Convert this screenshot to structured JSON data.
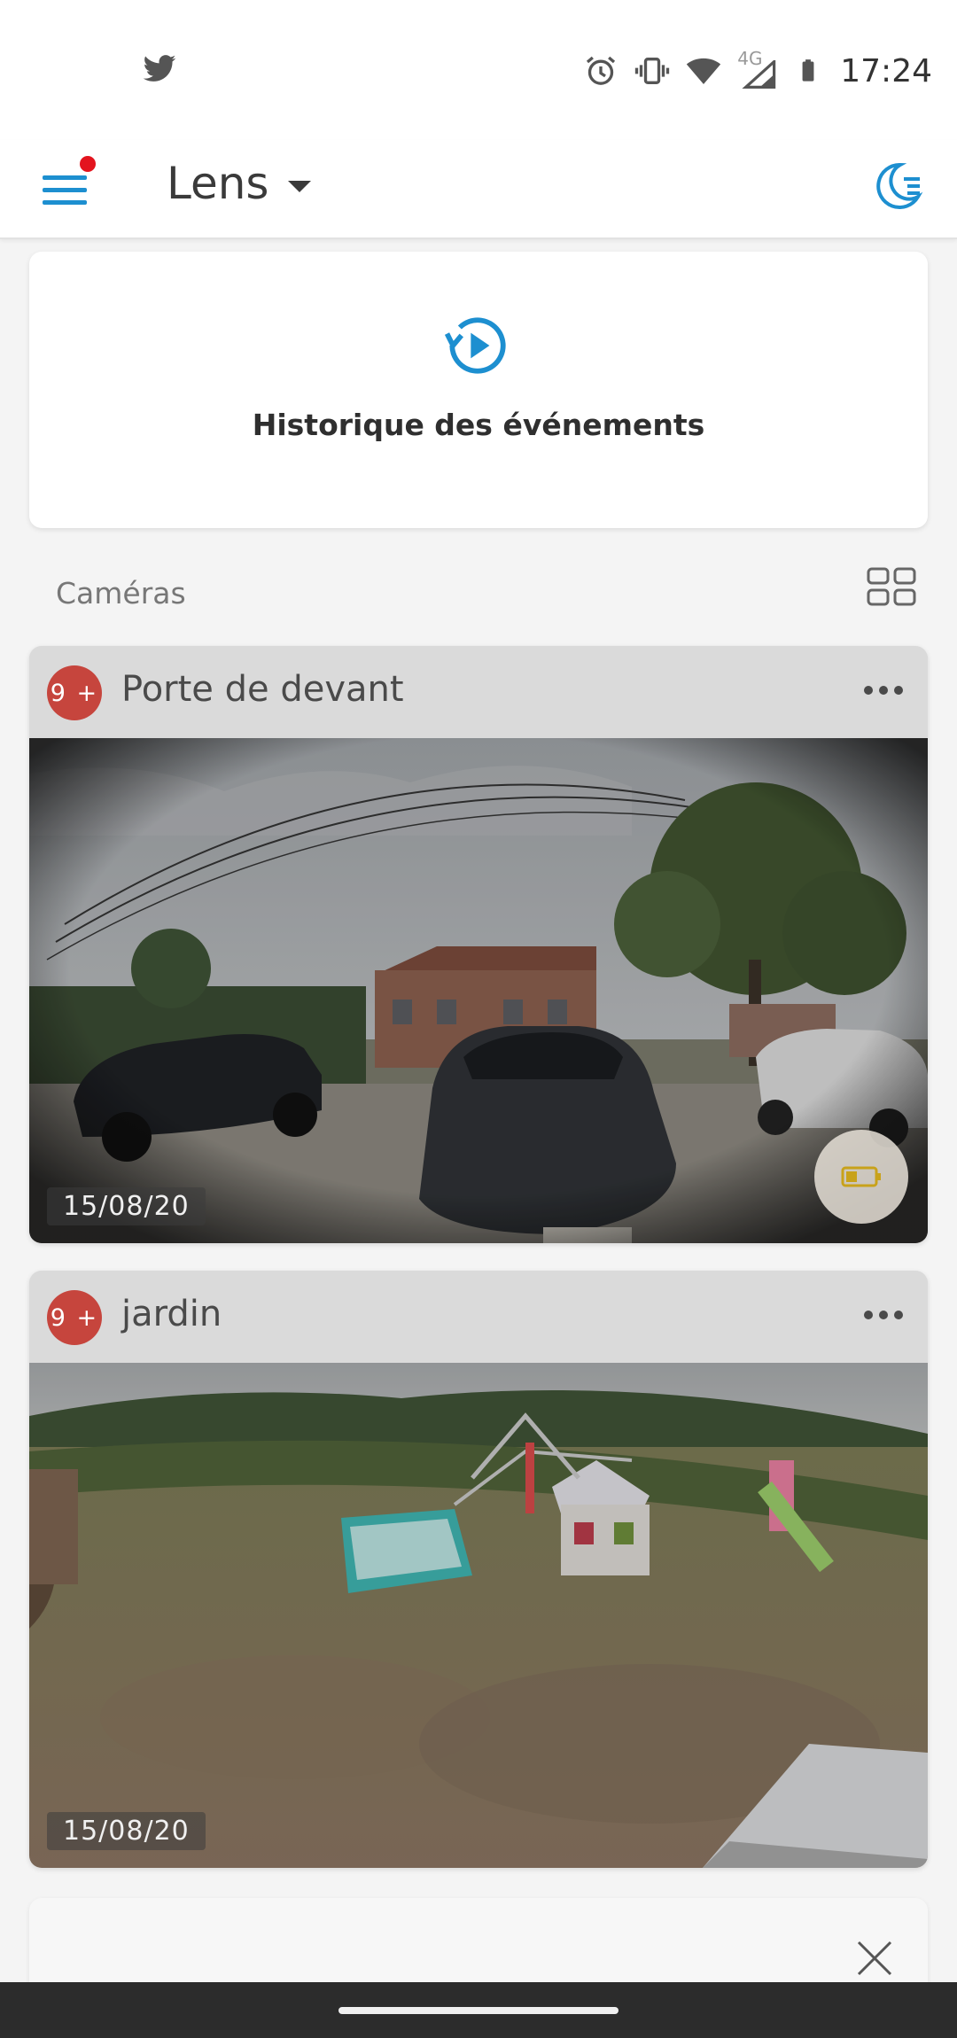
{
  "status_bar": {
    "time": "17:24",
    "network_label": "4G",
    "icons": [
      "twitter-icon",
      "alarm-icon",
      "vibrate-icon",
      "wifi-icon",
      "signal-icon",
      "battery-icon"
    ]
  },
  "header": {
    "title": "Lens",
    "menu_icon": "hamburger-menu-icon",
    "notification_dot_color": "#e3141e",
    "mode_icon": "moon-mode-icon",
    "accent_color": "#1d8fd0"
  },
  "history": {
    "label": "Historique des événements",
    "icon": "history-play-icon"
  },
  "cameras_section": {
    "label": "Caméras",
    "view_toggle_icon": "grid-view-icon"
  },
  "cameras": [
    {
      "name": "Porte de devant",
      "badge": "9 +",
      "date": "15/08/20",
      "has_battery_indicator": true,
      "battery_icon": "battery-low-icon",
      "feed_description": "front-door-feed"
    },
    {
      "name": "jardin",
      "badge": "9 +",
      "date": "15/08/20",
      "has_battery_indicator": false,
      "feed_description": "garden-feed"
    }
  ],
  "partial_card": {
    "close_icon": "close-icon"
  }
}
